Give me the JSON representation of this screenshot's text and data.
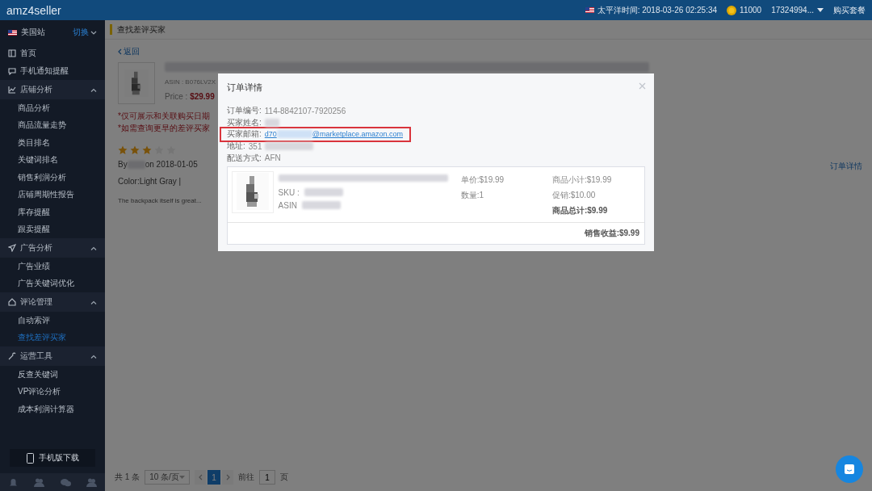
{
  "header": {
    "logo": "amz4seller",
    "time_label": "太平洋时间: 2018-03-26 02:25:34",
    "coins": "11000",
    "account": "17324994...",
    "buy_plan": "购买套餐"
  },
  "sidebar": {
    "site": "美国站",
    "switch": "切换",
    "items": [
      {
        "kind": "link",
        "label": "首页"
      },
      {
        "kind": "link",
        "label": "手机通知提醒"
      },
      {
        "kind": "group",
        "label": "店铺分析",
        "expanded": true,
        "children": [
          {
            "label": "商品分析",
            "selected": false
          },
          {
            "label": "商品流量走势",
            "selected": false
          },
          {
            "label": "类目排名",
            "selected": false
          },
          {
            "label": "关键词排名",
            "selected": false
          },
          {
            "label": "销售利润分析",
            "selected": false
          },
          {
            "label": "店铺周期性报告",
            "selected": false
          },
          {
            "label": "库存提醒",
            "selected": false
          },
          {
            "label": "跟卖提醒",
            "selected": false
          }
        ]
      },
      {
        "kind": "group",
        "label": "广告分析",
        "expanded": true,
        "children": [
          {
            "label": "广告业绩",
            "selected": false
          },
          {
            "label": "广告关键词优化",
            "selected": false
          }
        ]
      },
      {
        "kind": "group",
        "label": "评论管理",
        "expanded": true,
        "children": [
          {
            "label": "自动索评",
            "selected": false
          },
          {
            "label": "查找差评买家",
            "selected": true
          }
        ]
      },
      {
        "kind": "group",
        "label": "运营工具",
        "expanded": true,
        "children": [
          {
            "label": "反查关键词",
            "selected": false
          },
          {
            "label": "VP评论分析",
            "selected": false
          },
          {
            "label": "成本利润计算器",
            "selected": false
          }
        ]
      }
    ],
    "download": "手机版下载"
  },
  "page": {
    "breadcrumb": "查找差评买家",
    "back": "返回",
    "product": {
      "asin": "ASIN : B076LV2X",
      "price_label": "Price : ",
      "price": "$29.99"
    },
    "notes": [
      "*仅可展示和关联购买日期",
      "*如需查询更早的差评买家"
    ],
    "review": {
      "stars": 3,
      "by": "By",
      "date": "on 2018-01-05",
      "variant": "Color:Light Gray |",
      "text": "The backpack itself is great...",
      "order_link": "订单详情"
    },
    "pagination": {
      "total": "共 1 条",
      "page_size": "10 条/页",
      "pages": [
        {
          "label": "1",
          "selected": true
        }
      ],
      "goto": "前往",
      "goto_value": "1",
      "page_unit": "页"
    }
  },
  "modal": {
    "title": "订单详情",
    "fields": [
      {
        "kind": "text",
        "label": "订单编号:",
        "value": "114-8842107-7920256",
        "highlighted": false
      },
      {
        "kind": "hidden",
        "label": "买家姓名:",
        "highlighted": false
      },
      {
        "kind": "email",
        "label": "买家邮箱:",
        "value": "d70",
        "value_end": "@marketplace.amazon.com",
        "highlighted": true
      },
      {
        "kind": "partial",
        "label": "地址:",
        "value": "351",
        "highlighted": false
      },
      {
        "kind": "text",
        "label": "配送方式:",
        "value": "AFN",
        "highlighted": false
      }
    ],
    "item": {
      "sku_label": "SKU :",
      "asin_label": "ASIN",
      "unit_price": "单价:$19.99",
      "quantity": "数量:1",
      "subtotal": "商品小计:$19.99",
      "promo": "促销:$10.00",
      "total": "商品总计:$9.99",
      "revenue": "销售收益:$9.99"
    }
  }
}
